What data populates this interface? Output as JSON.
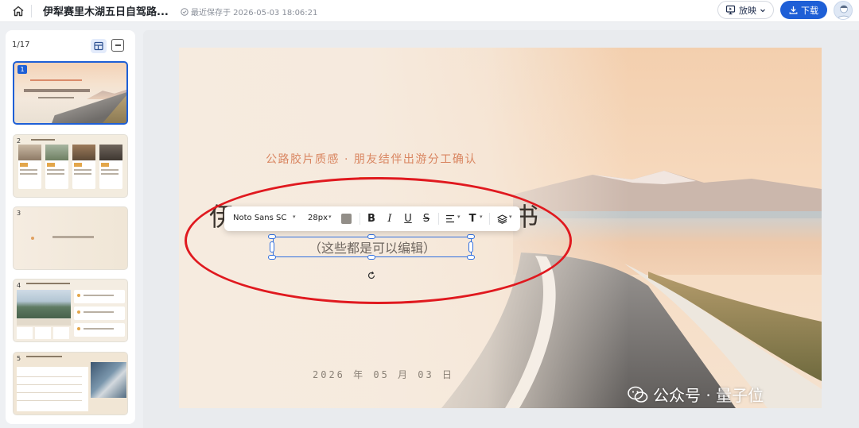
{
  "header": {
    "doc_title": "伊犁赛里木湖五日自驾路...",
    "save_status": "最近保存于 2026-05-03 18:06:21",
    "present_label": "放映",
    "download_label": "下载"
  },
  "sidebar": {
    "page_count": "1/17",
    "thumbnails": [
      {
        "number": "1"
      },
      {
        "number": "2"
      },
      {
        "number": "3"
      },
      {
        "number": "4"
      },
      {
        "number": "5"
      }
    ]
  },
  "slide": {
    "subtitle": "公路胶片质感 · 朋友结伴出游分工确认",
    "title_visible_start": "伊",
    "title_visible_end": "书",
    "textbox_text": "（这些都是可以编辑）",
    "date": "2026 年 05 月 03 日"
  },
  "toolbar": {
    "font_family": "Noto Sans SC",
    "font_size": "28px",
    "text_color": "#928e88",
    "bold": "B",
    "italic": "I",
    "underline": "U",
    "strikethrough": "S",
    "text_icon": "T"
  },
  "watermark": {
    "text": "公众号 · 量子位"
  },
  "colors": {
    "accent_blue": "#1e5fd6",
    "subtitle_orange": "#d98560",
    "annotation_red": "#e0191f"
  }
}
